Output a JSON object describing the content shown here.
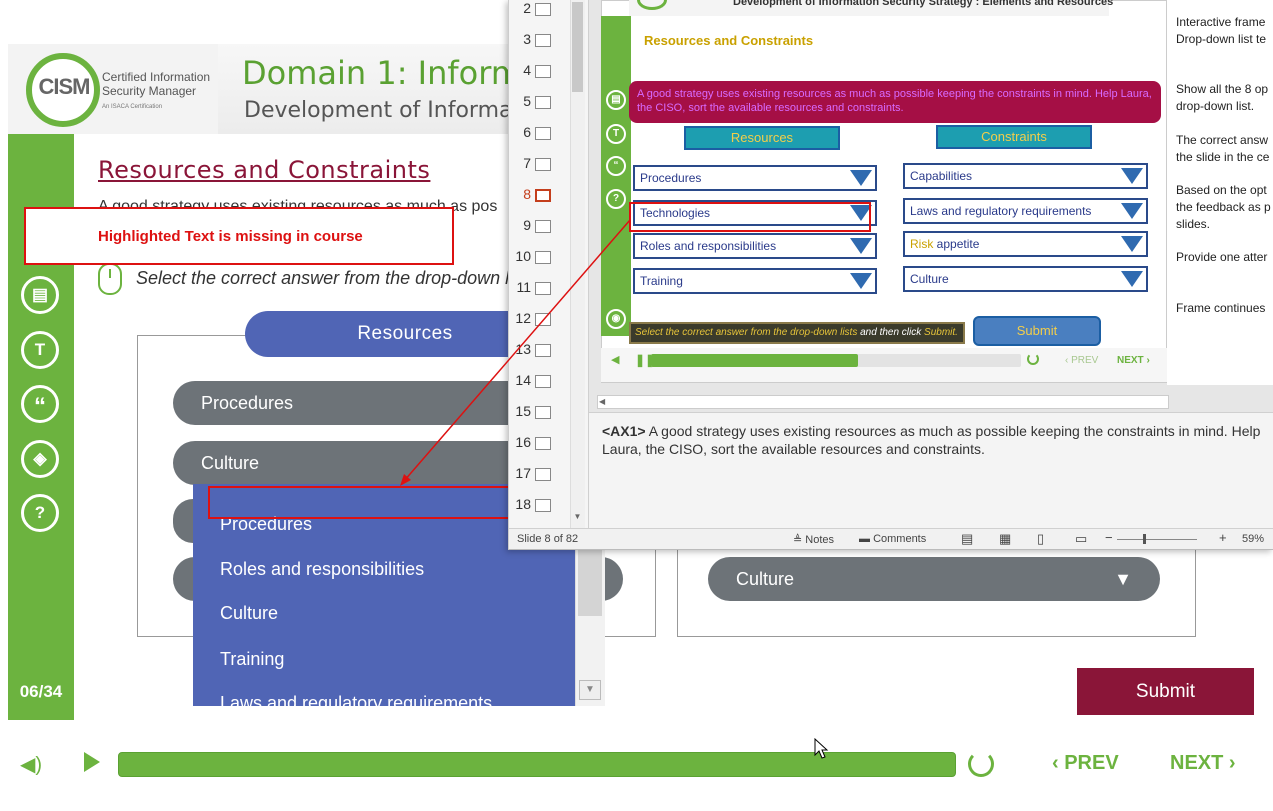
{
  "course": {
    "logo": {
      "abbr": "CISM",
      "line1": "Certified Information",
      "line2": "Security Manager",
      "sub": "An ISACA Certification"
    },
    "domain_title": "Domain 1: Informa",
    "domain_subtitle": "Development of Informatio",
    "heading": "Resources and Constraints",
    "intro": "A good strategy uses existing resources as much as pos",
    "instruction": "Select the correct answer from the drop-down lists,",
    "sidebar_icons": {
      "notes": "▤",
      "transcript": "T",
      "quote": "“",
      "layers": "◈",
      "help": "?"
    },
    "counter": "06/34",
    "resources_header": "Resources",
    "left_selects": [
      "Procedures",
      "Culture"
    ],
    "right_select": "Culture",
    "dropdown_options": [
      "Procedures",
      "Roles and responsibilities",
      "Culture",
      "Training",
      "Laws and regulatory requirements"
    ],
    "submit": "Submit",
    "player": {
      "prev": "PREV",
      "next": "NEXT",
      "progress": 1.0
    },
    "annotation": "Highlighted Text is missing in course"
  },
  "ppt": {
    "thumbnails": [
      {
        "n": "2"
      },
      {
        "n": "3"
      },
      {
        "n": "4"
      },
      {
        "n": "5"
      },
      {
        "n": "6"
      },
      {
        "n": "7"
      },
      {
        "n": "8",
        "active": true
      },
      {
        "n": "9"
      },
      {
        "n": "10"
      },
      {
        "n": "11"
      },
      {
        "n": "12"
      },
      {
        "n": "13"
      },
      {
        "n": "14"
      },
      {
        "n": "15"
      },
      {
        "n": "16"
      },
      {
        "n": "17"
      },
      {
        "n": "18"
      }
    ],
    "slide": {
      "header": "Development of Information Security Strategy : Elements and Resources",
      "title": "Resources and Constraints",
      "intro": "A good strategy uses existing resources as much as possible keeping the constraints in mind. Help Laura, the CISO, sort the available resources and constraints.",
      "resources_header": "Resources",
      "constraints_header": "Constraints",
      "resources": [
        "Procedures",
        "Technologies",
        "Roles and responsibilities",
        "Training"
      ],
      "constraints_a": [
        "Capabilities",
        "Laws and regulatory requirements"
      ],
      "risk_word": "Risk",
      "risk_rest": " appetite",
      "constraint_culture": "Culture",
      "instr_a": "Select the correct answer from the drop-down lists",
      "instr_b": " and then click ",
      "instr_c": "Submit.",
      "submit": "Submit",
      "prev": "‹ PREV",
      "next": "NEXT ›",
      "progress": 0.56
    },
    "side_notes": [
      "Interactive frame",
      "Drop-down list te",
      "Show all the 8 op",
      "drop-down list.",
      "The correct answ",
      "the slide in the ce",
      "Based on the opt",
      "the feedback as p",
      "slides.",
      "Provide one atter",
      "Frame continues"
    ],
    "notes_tag": "<AX1>",
    "notes_text": " A good strategy uses existing resources as much as possible keeping the constraints in mind. Help Laura, the CISO, sort the available resources and constraints.",
    "status": {
      "slide": "Slide 8 of 82",
      "notes": "Notes",
      "comments": "Comments",
      "zoom": "59%"
    }
  },
  "colors": {
    "green": "#6cb33f",
    "maroon": "#8a1538",
    "blue": "#5065b5",
    "annotation_red": "#dd1111"
  }
}
